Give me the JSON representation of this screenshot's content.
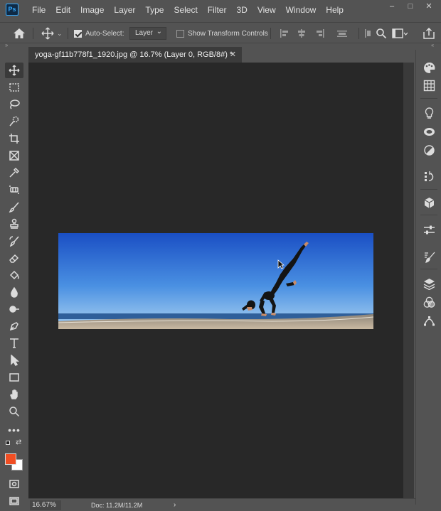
{
  "app": {
    "logo_text": "Ps",
    "menu": [
      "File",
      "Edit",
      "Image",
      "Layer",
      "Type",
      "Select",
      "Filter",
      "3D",
      "View",
      "Window",
      "Help"
    ],
    "window_controls": [
      "–",
      "□",
      "✕"
    ]
  },
  "options_bar": {
    "auto_select_label": "Auto-Select:",
    "auto_select_checked": true,
    "auto_select_target": "Layer",
    "transform_controls_label": "Show Transform Controls",
    "transform_controls_checked": false
  },
  "document": {
    "tab_title": "yoga-gf11b778f1_1920.jpg @ 16.7% (Layer 0, RGB/8#) *",
    "close_glyph": "✕",
    "image": {
      "description_icon": "yoga-photo",
      "sky_colors": [
        "#1d55c9",
        "#5a9ce6"
      ],
      "sea_color": "#2f5f9a",
      "sand_color": "#b6a68f"
    }
  },
  "colors": {
    "foreground": "#f04e23",
    "background": "#ffffff",
    "accent": "#31a8ff"
  },
  "status": {
    "zoom": "16.67%",
    "doc_size": "Doc: 11.2M/11.2M",
    "arrow": "›"
  },
  "tools": [
    "move-tool-icon",
    "marquee-tool-icon",
    "lasso-tool-icon",
    "quick-select-tool-icon",
    "crop-tool-icon",
    "frame-tool-icon",
    "eyedropper-tool-icon",
    "healing-brush-icon",
    "brush-tool-icon",
    "clone-stamp-icon",
    "history-brush-icon",
    "eraser-tool-icon",
    "paint-bucket-icon",
    "blur-tool-icon",
    "dodge-tool-icon",
    "pen-tool-icon",
    "type-tool-icon",
    "path-select-icon",
    "rectangle-tool-icon",
    "hand-tool-icon",
    "zoom-tool-icon",
    "more-tools-icon"
  ],
  "right_panel_icons": [
    "color-panel-icon",
    "swatches-panel-icon",
    "learn-panel-icon",
    "libraries-panel-icon",
    "adjustments-panel-icon",
    "history-panel-icon",
    "3d-panel-icon",
    "properties-panel-icon",
    "brushes-panel-icon",
    "layers-panel-icon",
    "channels-panel-icon",
    "paths-panel-icon"
  ]
}
